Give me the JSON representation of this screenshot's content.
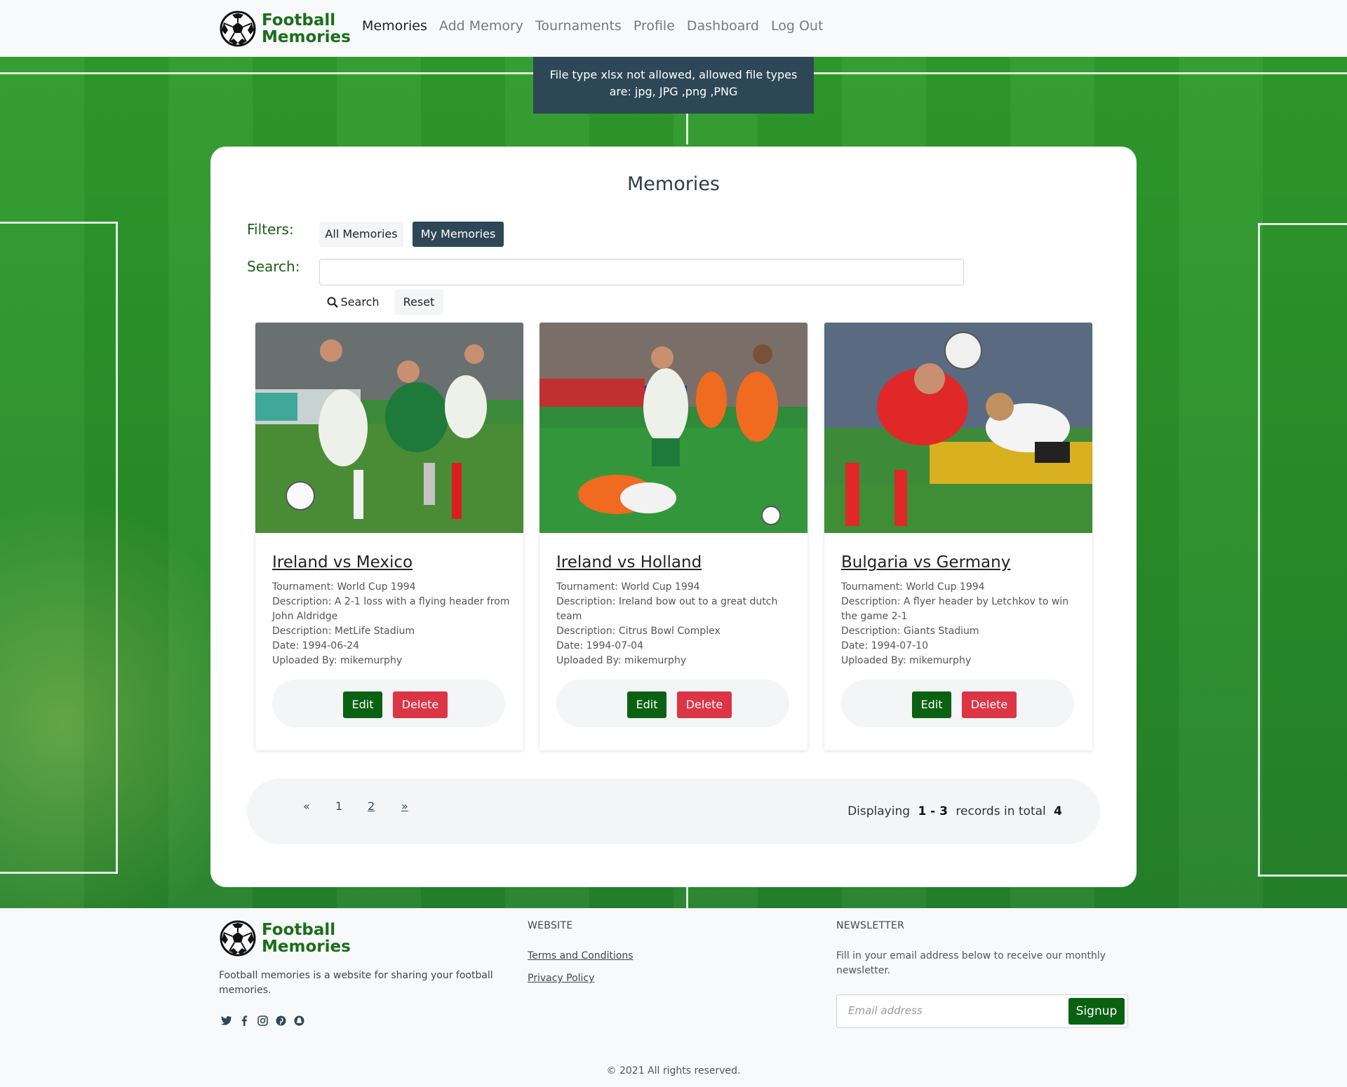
{
  "nav": {
    "brand_line1": "Football",
    "brand_line2": "Memories",
    "links": [
      "Memories",
      "Add Memory",
      "Tournaments",
      "Profile",
      "Dashboard",
      "Log Out"
    ]
  },
  "alert": {
    "message": "File type xlsx not allowed, allowed file types are: jpg, JPG ,png ,PNG"
  },
  "main": {
    "title": "Memories",
    "filters_label": "Filters:",
    "filter_all": "All Memories",
    "filter_mine": "My Memories",
    "search_label": "Search:",
    "search_value": "",
    "search_button": "Search",
    "reset_button": "Reset"
  },
  "memories": [
    {
      "title": "Ireland vs Mexico",
      "tournament": "Tournament: World Cup 1994",
      "description": "Description: A 2-1 loss with a flying header from John Aldridge",
      "venue": "Description: MetLife Stadium",
      "date": "Date: 1994-06-24",
      "uploaded_by": "Uploaded By: mikemurphy",
      "edit": "Edit",
      "delete": "Delete"
    },
    {
      "title": "Ireland vs Holland",
      "tournament": "Tournament: World Cup 1994",
      "description": "Description: Ireland bow out to a great dutch team",
      "venue": "Description: Citrus Bowl Complex",
      "date": "Date: 1994-07-04",
      "uploaded_by": "Uploaded By: mikemurphy",
      "edit": "Edit",
      "delete": "Delete"
    },
    {
      "title": "Bulgaria vs Germany",
      "tournament": "Tournament: World Cup 1994",
      "description": "Description: A flyer header by Letchkov to win the game 2-1",
      "venue": "Description: Giants Stadium",
      "date": "Date: 1994-07-10",
      "uploaded_by": "Uploaded By: mikemurphy",
      "edit": "Edit",
      "delete": "Delete"
    }
  ],
  "pagination": {
    "prev": "«",
    "page1": "1",
    "page2": "2",
    "next": "»",
    "displaying_label": "Displaying",
    "range": "1 - 3",
    "total_label": "records in total",
    "total": "4"
  },
  "footer": {
    "brand_line1": "Football",
    "brand_line2": "Memories",
    "description": "Football memories is a website for sharing your football memories.",
    "website_heading": "WEBSITE",
    "terms": "Terms and Conditions",
    "privacy": "Privacy Policy",
    "newsletter_heading": "NEWSLETTER",
    "newsletter_text": "Fill in your email address below to receive our monthly newsletter.",
    "email_placeholder": "Email address",
    "signup": "Signup",
    "copyright": "© 2021 All rights reserved."
  },
  "social_icons": [
    "twitter-icon",
    "facebook-icon",
    "instagram-icon",
    "pinterest-icon",
    "snapchat-icon"
  ],
  "colors": {
    "brand_green": "#1b6e1b",
    "dark_slate": "#2d4756",
    "edit_green": "#0b6112",
    "delete_red": "#dc3545"
  }
}
